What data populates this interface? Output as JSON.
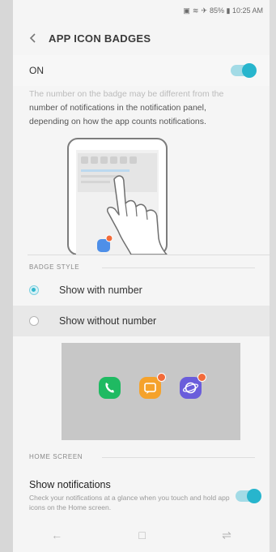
{
  "status": {
    "text": "85% ▮ 10:25 AM",
    "icons": [
      "notification-icon",
      "wifi-icon",
      "signal-icon"
    ]
  },
  "header": {
    "title": "APP ICON BADGES"
  },
  "toggle_main": {
    "label": "ON",
    "state": "on"
  },
  "description": {
    "faded": "The number on the badge may be different from the",
    "line2": "number of notifications in the notification panel,",
    "line3": "depending on how the app counts notifications."
  },
  "badge_style": {
    "section": "BADGE STYLE",
    "options": [
      {
        "label": "Show with number",
        "selected": true
      },
      {
        "label": "Show without number",
        "selected": false
      }
    ]
  },
  "home_screen": {
    "section": "HOME SCREEN",
    "title": "Show notifications",
    "subtitle": "Check your notifications at a glance when you touch and hold app icons on the Home screen.",
    "state": "on"
  },
  "colors": {
    "accent": "#27b5cd",
    "phone": "#1fba62",
    "message": "#f5a22b",
    "internet": "#6a5ddb",
    "badge": "#f26b3a"
  },
  "nav": [
    "back-icon",
    "home-icon",
    "recents-icon"
  ]
}
